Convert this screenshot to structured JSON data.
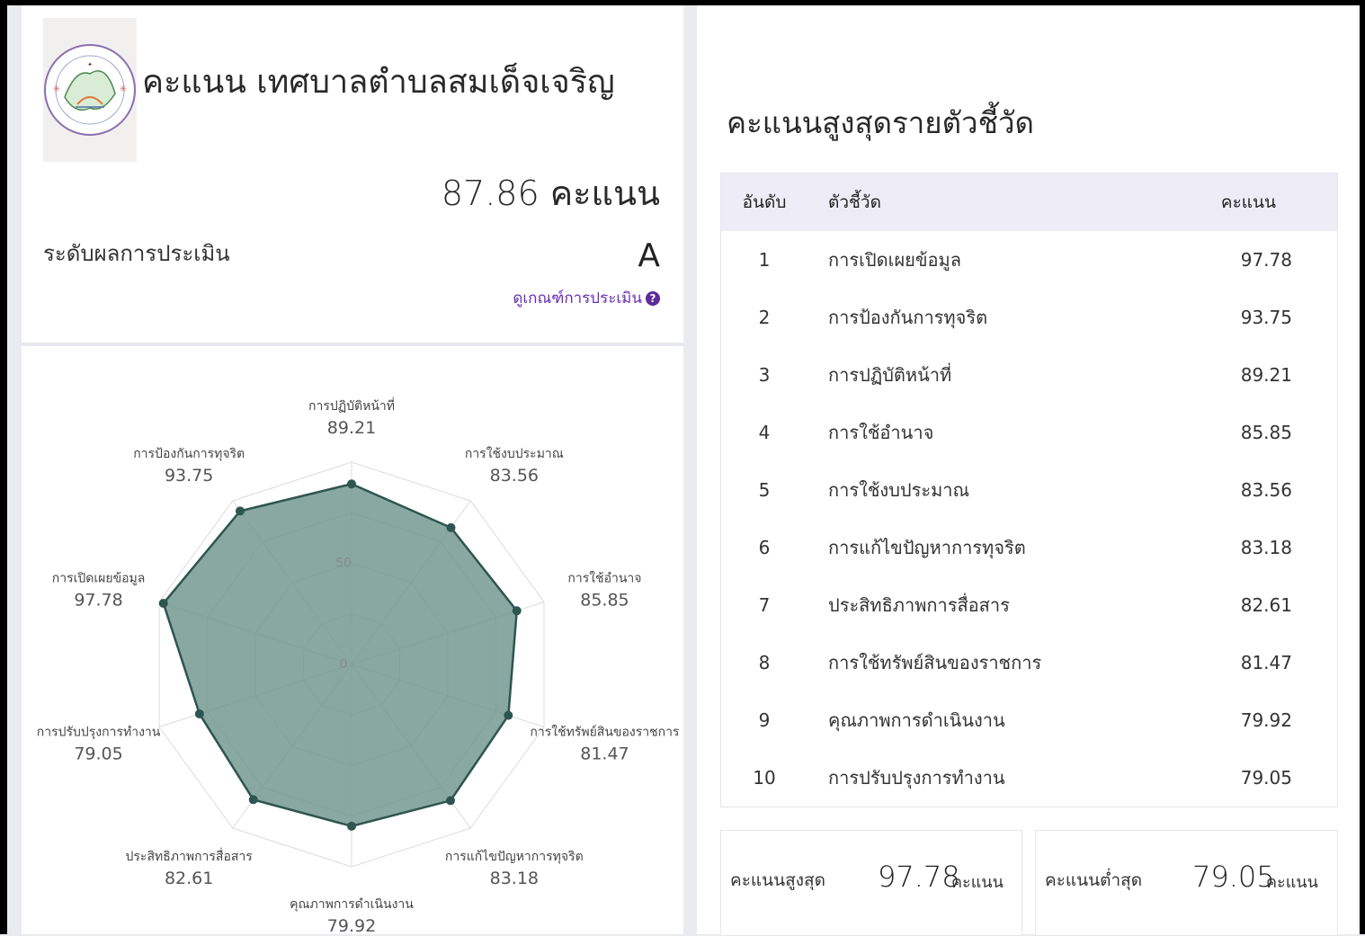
{
  "header": {
    "org_title": "คะแนน เทศบาลตำบลสมเด็จเจริญ",
    "total_score_text": "87.86 คะแนน",
    "level_label": "ระดับผลการประเมิน",
    "grade": "A",
    "criteria_link": "ดูเกณฑ์การประเมิน"
  },
  "icons": {
    "help": "question-circle-icon",
    "logo": "municipality-seal"
  },
  "colors": {
    "radar_fill": "#6f958d",
    "radar_stroke": "#2e554f",
    "header_bg": "#eeecf6",
    "link": "#6a2fb0"
  },
  "chart_data": {
    "type": "radar",
    "axes": [
      "การปฏิบัติหน้าที่",
      "การใช้งบประมาณ",
      "การใช้อำนาจ",
      "การใช้ทรัพย์สินของราชการ",
      "การแก้ไขปัญหาการทุจริต",
      "คุณภาพการดำเนินงาน",
      "ประสิทธิภาพการสื่อสาร",
      "การปรับปรุงการทำงาน",
      "การเปิดเผยข้อมูล",
      "การป้องกันการทุจริต"
    ],
    "values": [
      89.21,
      83.56,
      85.85,
      81.47,
      83.18,
      79.92,
      82.61,
      79.05,
      97.78,
      93.75
    ],
    "value_labels": [
      "89.21",
      "83.56",
      "85.85",
      "81.47",
      "83.18",
      "79.92",
      "82.61",
      "79.05",
      "97.78",
      "93.75"
    ],
    "range": [
      0,
      100
    ],
    "tick_labels": [
      "0",
      "50"
    ]
  },
  "table": {
    "title": "คะแนนสูงสุดรายตัวชี้วัด",
    "headers": {
      "rank": "อันดับ",
      "indicator": "ตัวชี้วัด",
      "score": "คะแนน"
    },
    "rows": [
      {
        "rank": "1",
        "indicator": "การเปิดเผยข้อมูล",
        "score": "97.78"
      },
      {
        "rank": "2",
        "indicator": "การป้องกันการทุจริต",
        "score": "93.75"
      },
      {
        "rank": "3",
        "indicator": "การปฏิบัติหน้าที่",
        "score": "89.21"
      },
      {
        "rank": "4",
        "indicator": "การใช้อำนาจ",
        "score": "85.85"
      },
      {
        "rank": "5",
        "indicator": "การใช้งบประมาณ",
        "score": "83.56"
      },
      {
        "rank": "6",
        "indicator": "การแก้ไขปัญหาการทุจริต",
        "score": "83.18"
      },
      {
        "rank": "7",
        "indicator": "ประสิทธิภาพการสื่อสาร",
        "score": "82.61"
      },
      {
        "rank": "8",
        "indicator": "การใช้ทรัพย์สินของราชการ",
        "score": "81.47"
      },
      {
        "rank": "9",
        "indicator": "คุณภาพการดำเนินงาน",
        "score": "79.92"
      },
      {
        "rank": "10",
        "indicator": "การปรับปรุงการทำงาน",
        "score": "79.05"
      }
    ]
  },
  "summary": {
    "max_label": "คะแนนสูงสุด",
    "max_value": "97.78",
    "min_label": "คะแนนต่ำสุด",
    "min_value": "79.05",
    "unit": "คะแนน"
  }
}
